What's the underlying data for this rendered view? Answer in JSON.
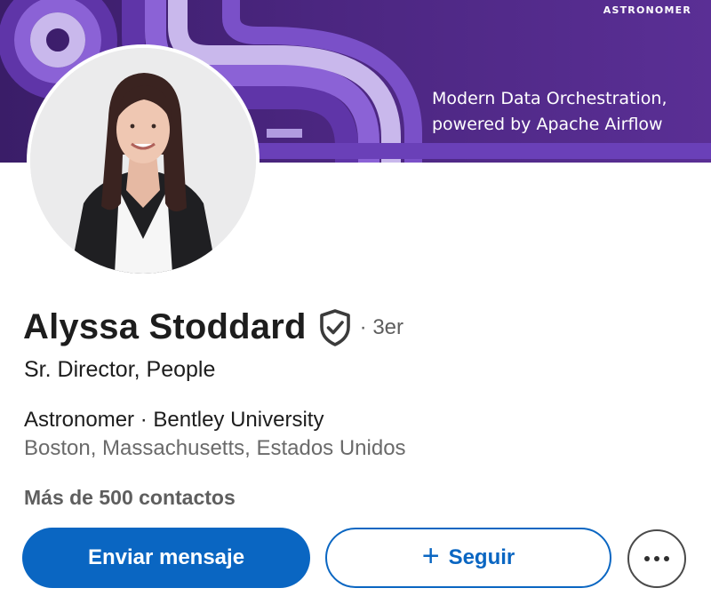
{
  "banner": {
    "brand": "ASTRONOMER",
    "tagline_line1": "Modern Data Orchestration,",
    "tagline_line2": "powered by Apache Airflow",
    "colors": {
      "background": "#4b2680",
      "stripe_light": "#c9b8ec",
      "stripe_mid": "#8b62d6",
      "stripe_dark": "#5f35a8"
    }
  },
  "profile": {
    "name": "Alyssa Stoddard",
    "verified_icon": "shield-check-icon",
    "degree": "· 3er",
    "headline": "Sr. Director, People",
    "company_line": "Astronomer · Bentley University",
    "location": "Boston, Massachusetts, Estados Unidos",
    "connections": "Más de 500 contactos"
  },
  "actions": {
    "message_label": "Enviar mensaje",
    "follow_label": "Seguir",
    "follow_icon": "+",
    "more_icon": "more-horizontal-icon"
  },
  "colors": {
    "primary_blue": "#0a66c2",
    "text_dark": "#1d1d1d",
    "text_muted": "#6a6a6a"
  }
}
